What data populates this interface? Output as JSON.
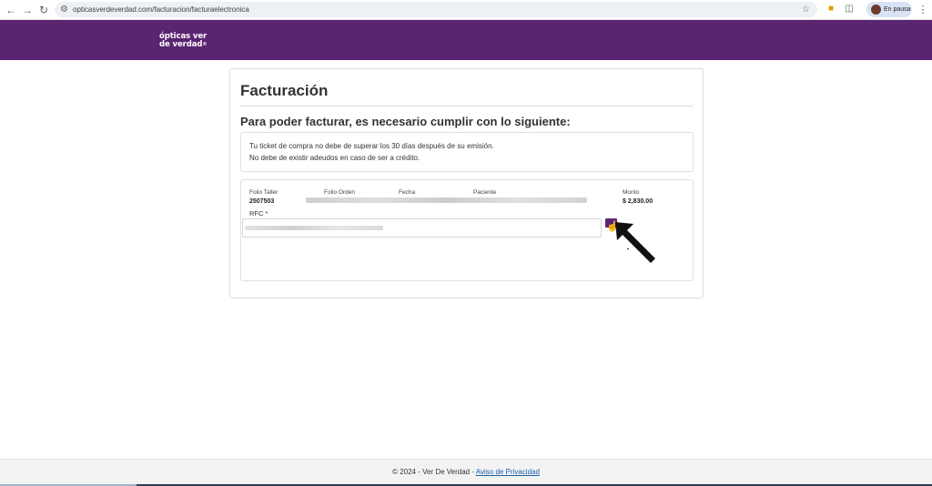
{
  "browser": {
    "back_icon": "←",
    "forward_icon": "→",
    "reload_icon": "↻",
    "tune_icon": "⚙",
    "url": "opticasverdeverdad.com/facturacion/facturaelectronica",
    "star_icon": "☆",
    "profile_label": "En pausa",
    "menu_icon": "⋮"
  },
  "site": {
    "logo_line1": "ópticas ver",
    "logo_line2": "de verdad",
    "logo_mark": "®",
    "brand_color": "#5a2470"
  },
  "page": {
    "title": "Facturación",
    "subtitle": "Para poder facturar, es necesario cumplir con lo siguiente:",
    "requirements": [
      "Tu ticket de compra no debe de superar los 30 días después de su emisión.",
      "No debe de existir adeudos en caso de ser a crédito."
    ]
  },
  "ticket": {
    "headers": {
      "folio_taller": "Folio Taller",
      "folio_orden": "Folio Orden",
      "fecha": "Fecha",
      "paciente": "Paciente",
      "monto": "Monto"
    },
    "values": {
      "folio_taller": "2507503",
      "monto": "$  2,830.00"
    },
    "rfc_label": "RFC *"
  },
  "footer": {
    "copyright": "© 2024 - Ver De Verdad - ",
    "privacy_link": "Aviso de Privacidad"
  }
}
